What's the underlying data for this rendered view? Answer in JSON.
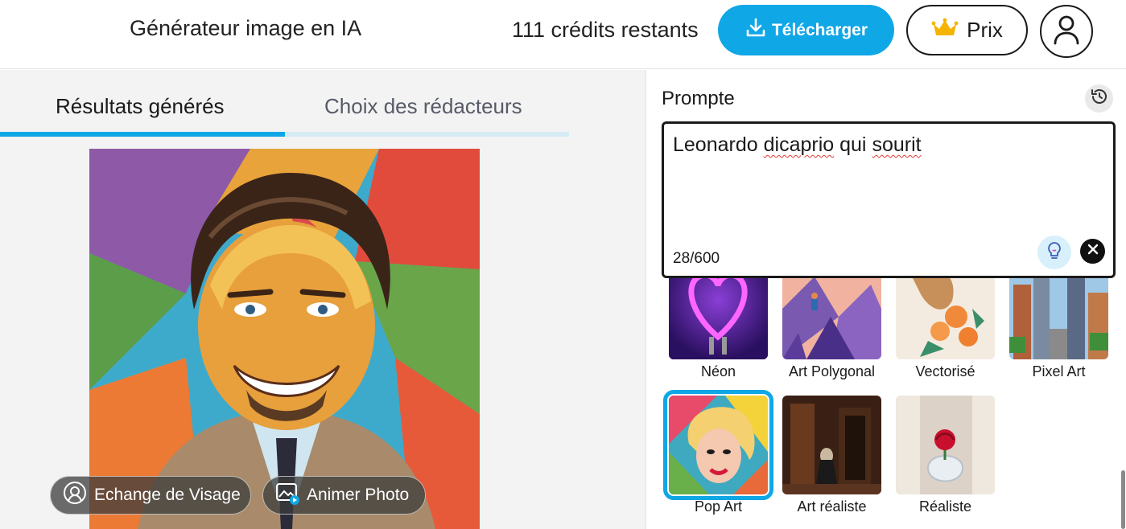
{
  "header": {
    "app_title": "Générateur image en IA",
    "credits": "111 crédits restants",
    "download_label": "Télécharger",
    "price_label": "Prix",
    "icons": {
      "download": "download-icon",
      "price": "crown-icon",
      "account": "user-icon"
    }
  },
  "tabs": [
    {
      "label": "Résultats générés",
      "active": true
    },
    {
      "label": "Choix des rédacteurs",
      "active": false
    }
  ],
  "result": {
    "face_swap_label": "Echange de Visage",
    "animate_label": "Animer Photo"
  },
  "prompt": {
    "title": "Prompte",
    "text_parts": [
      "Leonardo ",
      "dicaprio",
      " qui ",
      "sourit"
    ],
    "count": "28/600"
  },
  "styles": [
    {
      "label": "Néon",
      "selected": false
    },
    {
      "label": "Art Polygonal",
      "selected": false
    },
    {
      "label": "Vectorisé",
      "selected": false
    },
    {
      "label": "Pixel Art",
      "selected": false
    },
    {
      "label": "Pop Art",
      "selected": true
    },
    {
      "label": "Art réaliste",
      "selected": false
    },
    {
      "label": "Réaliste",
      "selected": false
    }
  ],
  "colors": {
    "accent": "#0fa7e6",
    "accent_light": "#d6ecf5",
    "panel_bg": "#f3f3f3"
  }
}
